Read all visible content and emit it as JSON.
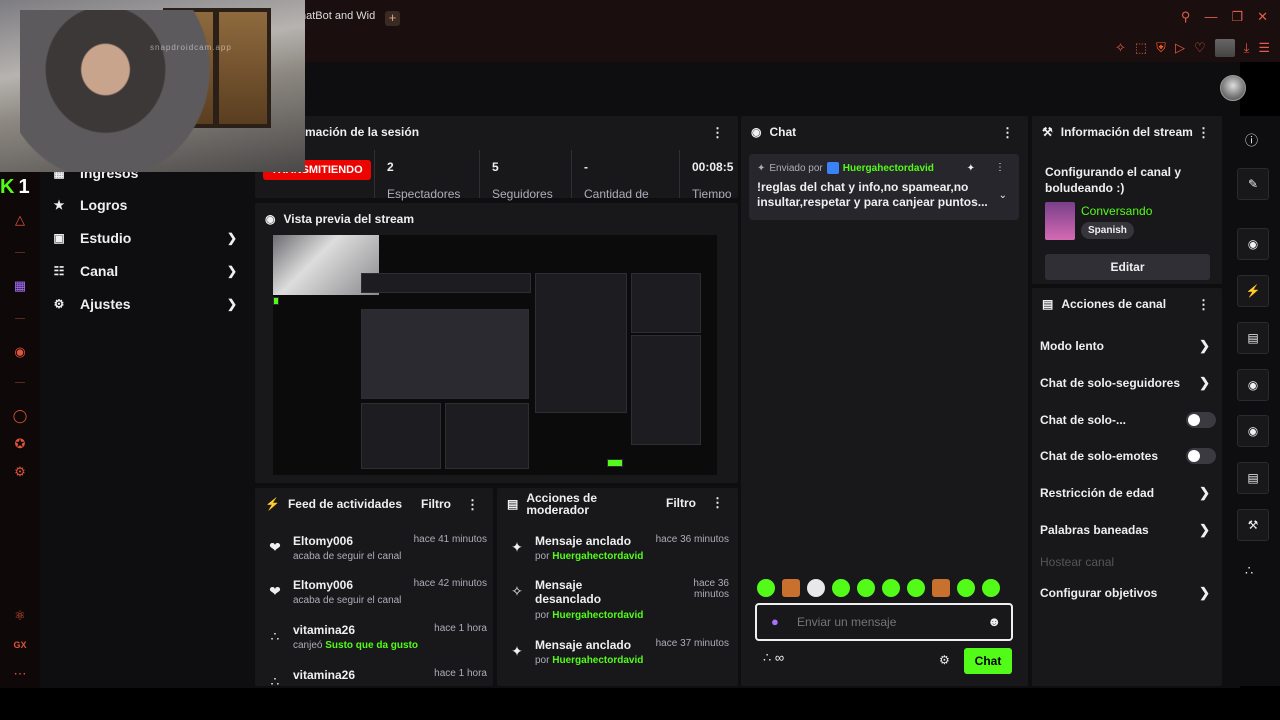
{
  "browser": {
    "tab_title": "hatBot and Wid",
    "tab_plus": "+"
  },
  "nav": {
    "items": [
      {
        "label": "Ingresos"
      },
      {
        "label": "Logros"
      },
      {
        "label": "Estudio"
      },
      {
        "label": "Canal"
      },
      {
        "label": "Ajustes"
      }
    ],
    "logo_letter": "K",
    "logo_number": "1"
  },
  "session": {
    "title": "mación de la sesión",
    "live_badge": "TRANSMITIENDO",
    "stats": [
      {
        "value": "2",
        "label": "Espectadores"
      },
      {
        "value": "5",
        "label": "Seguidores"
      },
      {
        "value": "-",
        "label": "Cantidad de"
      },
      {
        "value": "00:08:5",
        "label": "Tiempo"
      }
    ]
  },
  "preview": {
    "title": "Vista previa del stream"
  },
  "feed": {
    "title": "Feed de actividades",
    "filter": "Filtro",
    "entries": [
      {
        "user": "Eltomy006",
        "action": "acaba de seguir el canal",
        "time": "hace 41 minutos",
        "icon": "heart-icon"
      },
      {
        "user": "Eltomy006",
        "action": "acaba de seguir el canal",
        "time": "hace 42 minutos",
        "icon": "heart-icon"
      },
      {
        "user": "vitamina26",
        "action": "canjeó",
        "reward": "Susto que da gusto",
        "time": "hace 1 hora",
        "icon": "points-icon"
      },
      {
        "user": "vitamina26",
        "action": "",
        "time": "hace 1 hora",
        "icon": "points-icon"
      }
    ]
  },
  "modactions": {
    "title_line1": "Acciones de",
    "title_line2": "moderador",
    "filter": "Filtro",
    "entries": [
      {
        "action": "Mensaje anclado",
        "by": "por",
        "user": "Huergahectordavid",
        "time": "hace 36 minutos",
        "icon": "pin-icon"
      },
      {
        "action_line1": "Mensaje",
        "action_line2": "desanclado",
        "by": "por",
        "user": "Huergahectordavid",
        "time_line1": "hace 36",
        "time_line2": "minutos",
        "icon": "unpin-icon"
      },
      {
        "action": "Mensaje anclado",
        "by": "por",
        "user": "Huergahectordavid",
        "time": "hace 37 minutos",
        "icon": "pin-icon"
      }
    ]
  },
  "chat": {
    "title": "Chat",
    "pinned_prefix": "Enviado por",
    "pinned_user": "Huergahectordavid",
    "pinned_message": "!reglas del chat y info,no spamear,no insultar,respetar y para canjear puntos...",
    "input_placeholder": "Enviar un mensaje",
    "send_label": "Chat",
    "points_label": "∞"
  },
  "stream_info": {
    "title": "Información del stream",
    "stream_title": "Configurando el canal y boludeando :)",
    "category": "Conversando",
    "tag": "Spanish",
    "edit_label": "Editar"
  },
  "channel_actions": {
    "title": "Acciones de canal",
    "items": [
      {
        "label": "Modo lento",
        "control": "arrow"
      },
      {
        "label": "Chat de solo-seguidores",
        "control": "arrow"
      },
      {
        "label": "Chat de solo-...",
        "control": "toggle"
      },
      {
        "label": "Chat de solo-emotes",
        "control": "toggle"
      },
      {
        "label": "Restricción de edad",
        "control": "arrow"
      },
      {
        "label": "Palabras baneadas",
        "control": "arrow"
      },
      {
        "label": "Hostear canal",
        "control": "none",
        "disabled": true
      },
      {
        "label": "Configurar objetivos",
        "control": "arrow"
      }
    ]
  },
  "colors": {
    "accent": "#53fc18",
    "live": "#eb0400",
    "panel": "#18181b",
    "background": "#0e0e10",
    "browser_accent": "#e0533c"
  },
  "webcam": {
    "watermark": "snapdroidcam.app"
  }
}
